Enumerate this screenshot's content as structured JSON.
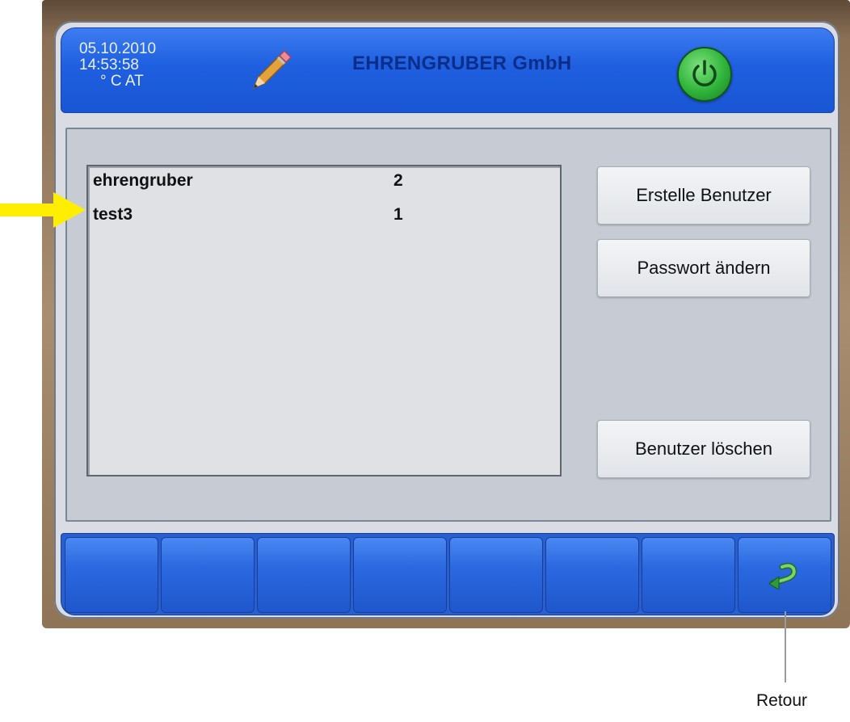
{
  "header": {
    "date": "05.10.2010",
    "time": "14:53:58",
    "unit": "° C  AT",
    "title": "EHRENGRUBER GmbH",
    "edit_icon": "pencil-icon",
    "power_icon": "power-icon"
  },
  "user_list": {
    "rows": [
      {
        "name": "ehrengruber",
        "level": "2"
      },
      {
        "name": "test3",
        "level": "1"
      }
    ]
  },
  "actions": {
    "create_user": "Erstelle Benutzer",
    "change_password": "Passwort ändern",
    "delete_user": "Benutzer löschen"
  },
  "function_bar": {
    "return_icon": "return-arrow-icon"
  },
  "annotations": {
    "arrow_color": "#ffee00",
    "callout_label": "Retour"
  },
  "colors": {
    "header_blue": "#1e5fe0",
    "title_text": "#0b2e8a",
    "power_green": "#2fb43a",
    "panel_gray": "#c7ccd4"
  }
}
